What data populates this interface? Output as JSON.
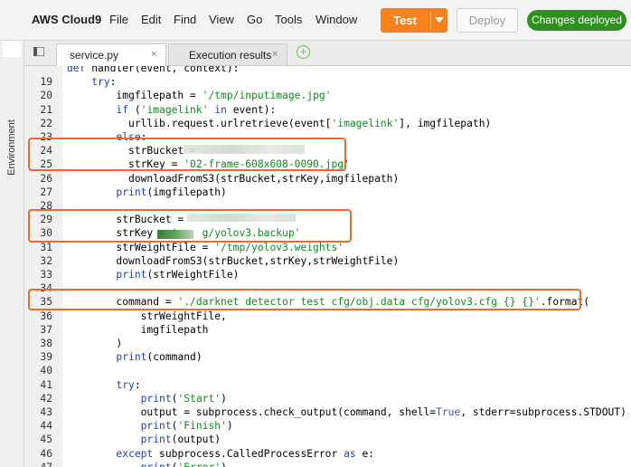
{
  "menubar": {
    "brand": "AWS Cloud9",
    "items": [
      "File",
      "Edit",
      "Find",
      "View",
      "Go",
      "Tools",
      "Window"
    ],
    "test_label": "Test",
    "deploy_label": "Deploy",
    "status_badge": "Changes deployed"
  },
  "sidebar": {
    "environment_label": "Environment"
  },
  "tabs": [
    {
      "label": "service.py",
      "close": "×"
    },
    {
      "label": "Execution results",
      "close": "×"
    }
  ],
  "add_tab_icon": "+",
  "editor": {
    "lines": [
      {
        "n": "",
        "text": "def handler(event, context):"
      },
      {
        "n": "19",
        "text": "    try:"
      },
      {
        "n": "20",
        "text": "        imgfilepath = '/tmp/inputimage.jpg'"
      },
      {
        "n": "21",
        "text": "        if ('imagelink' in event):"
      },
      {
        "n": "22",
        "text": "          urllib.request.urlretrieve(event['imagelink'], imgfilepath)"
      },
      {
        "n": "23",
        "text": "        else:"
      },
      {
        "n": "24",
        "text": "          strBucket = '"
      },
      {
        "n": "25",
        "text": "          strKey = '02-frame-608x608-0090.jpg'"
      },
      {
        "n": "26",
        "text": "          downloadFromS3(strBucket,strKey,imgfilepath)"
      },
      {
        "n": "27",
        "text": "        print(imgfilepath)"
      },
      {
        "n": "28",
        "text": ""
      },
      {
        "n": "29",
        "text": "        strBucket = '"
      },
      {
        "n": "30",
        "text": "        strKey = '    g/yolov3.backup'"
      },
      {
        "n": "31",
        "text": "        strWeightFile = '/tmp/yolov3.weights'"
      },
      {
        "n": "32",
        "text": "        downloadFromS3(strBucket,strKey,strWeightFile)"
      },
      {
        "n": "33",
        "text": "        print(strWeightFile)"
      },
      {
        "n": "34",
        "text": ""
      },
      {
        "n": "35",
        "text": "        command = './darknet detector test cfg/obj.data cfg/yolov3.cfg {} {}'.format("
      },
      {
        "n": "36",
        "text": "            strWeightFile,"
      },
      {
        "n": "37",
        "text": "            imgfilepath"
      },
      {
        "n": "38",
        "text": "        )"
      },
      {
        "n": "39",
        "text": "        print(command)"
      },
      {
        "n": "40",
        "text": ""
      },
      {
        "n": "41",
        "text": "        try:"
      },
      {
        "n": "42",
        "text": "            print('Start')"
      },
      {
        "n": "43",
        "text": "            output = subprocess.check_output(command, shell=True, stderr=subprocess.STDOUT)"
      },
      {
        "n": "44",
        "text": "            print('Finish')"
      },
      {
        "n": "45",
        "text": "            print(output)"
      },
      {
        "n": "46",
        "text": "        except subprocess.CalledProcessError as e:"
      },
      {
        "n": "47",
        "text": "            print('Error')"
      }
    ]
  },
  "colors": {
    "accent_orange": "#f7821b",
    "success_green": "#2f8f1f",
    "highlight_box": "#ee6a2c",
    "keyword_blue": "#1b3fbf",
    "string_green": "#0f8a1f"
  }
}
